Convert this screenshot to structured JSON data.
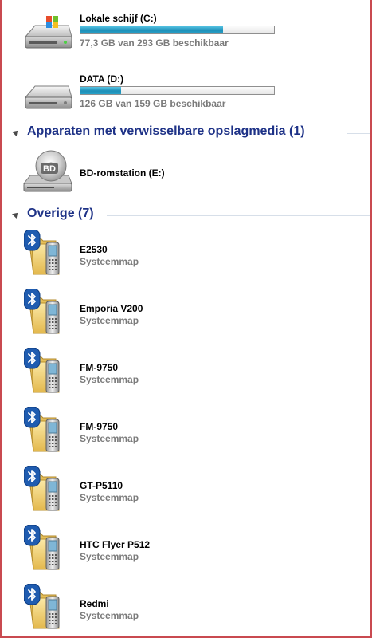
{
  "drives": [
    {
      "name": "Lokale schijf (C:)",
      "usage": "77,3 GB van 293 GB beschikbaar",
      "used_fraction": 0.736,
      "icon": "windows-drive-icon"
    },
    {
      "name": "DATA (D:)",
      "usage": "126 GB van 159 GB beschikbaar",
      "used_fraction": 0.208,
      "icon": "hard-drive-icon"
    }
  ],
  "groups": {
    "removable": {
      "title": "Apparaten met verwisselbare opslagmedia (1)",
      "items": [
        {
          "name": "BD-romstation (E:)",
          "icon": "bd-rom-drive-icon",
          "disc_label": "BD"
        }
      ]
    },
    "other": {
      "title": "Overige (7)",
      "items": [
        {
          "name": "E2530",
          "type": "Systeemmap",
          "icon": "bluetooth-phone-folder-icon"
        },
        {
          "name": "Emporia V200",
          "type": "Systeemmap",
          "icon": "bluetooth-phone-folder-icon"
        },
        {
          "name": "FM-9750",
          "type": "Systeemmap",
          "icon": "bluetooth-phone-folder-icon"
        },
        {
          "name": "FM-9750",
          "type": "Systeemmap",
          "icon": "bluetooth-phone-folder-icon"
        },
        {
          "name": "GT-P5110",
          "type": "Systeemmap",
          "icon": "bluetooth-phone-folder-icon"
        },
        {
          "name": "HTC Flyer P512",
          "type": "Systeemmap",
          "icon": "bluetooth-phone-folder-icon"
        },
        {
          "name": "Redmi",
          "type": "Systeemmap",
          "icon": "bluetooth-phone-folder-icon"
        }
      ]
    }
  },
  "colors": {
    "group_title": "#1e3287",
    "bar_fill": "#2aa2c9",
    "bar_fill_light": "#56c3e3",
    "secondary_text": "#7b7b7b",
    "frame_border": "#c94a50"
  }
}
